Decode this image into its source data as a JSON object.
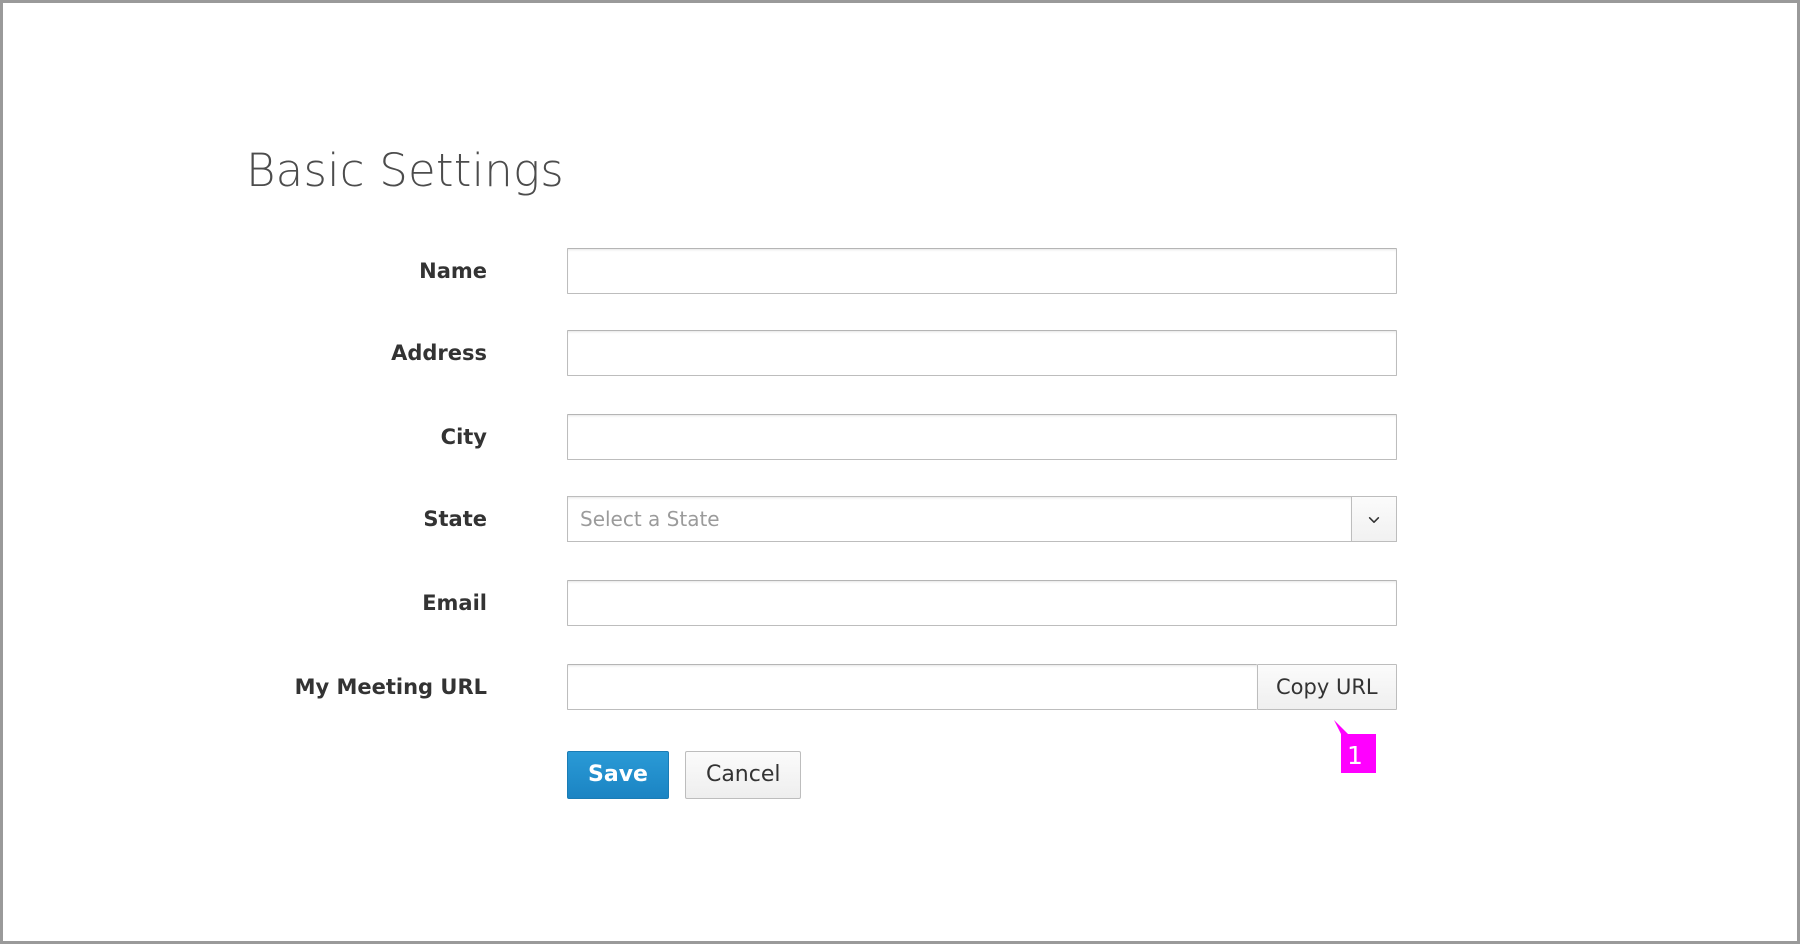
{
  "page": {
    "title": "Basic Settings",
    "border_color": "#9a9a9a",
    "background": "#ffffff"
  },
  "form": {
    "fields": [
      {
        "label": "Name",
        "type": "text",
        "value": "",
        "placeholder": ""
      },
      {
        "label": "Address",
        "type": "text",
        "value": "",
        "placeholder": ""
      },
      {
        "label": "City",
        "type": "text",
        "value": "",
        "placeholder": ""
      },
      {
        "label": "State",
        "type": "select",
        "value": "",
        "placeholder": "Select a State",
        "toggle_icon": "chevron-down-icon"
      },
      {
        "label": "Email",
        "type": "text",
        "value": "",
        "placeholder": ""
      },
      {
        "label": "My Meeting URL",
        "type": "text-with-button",
        "value": "",
        "placeholder": "",
        "button_label": "Copy URL"
      }
    ]
  },
  "actions": {
    "save_label": "Save",
    "cancel_label": "Cancel",
    "primary_color": "#1b84c3"
  },
  "annotation": {
    "number": "1",
    "color": "#ff00ff",
    "target": "Copy URL"
  }
}
